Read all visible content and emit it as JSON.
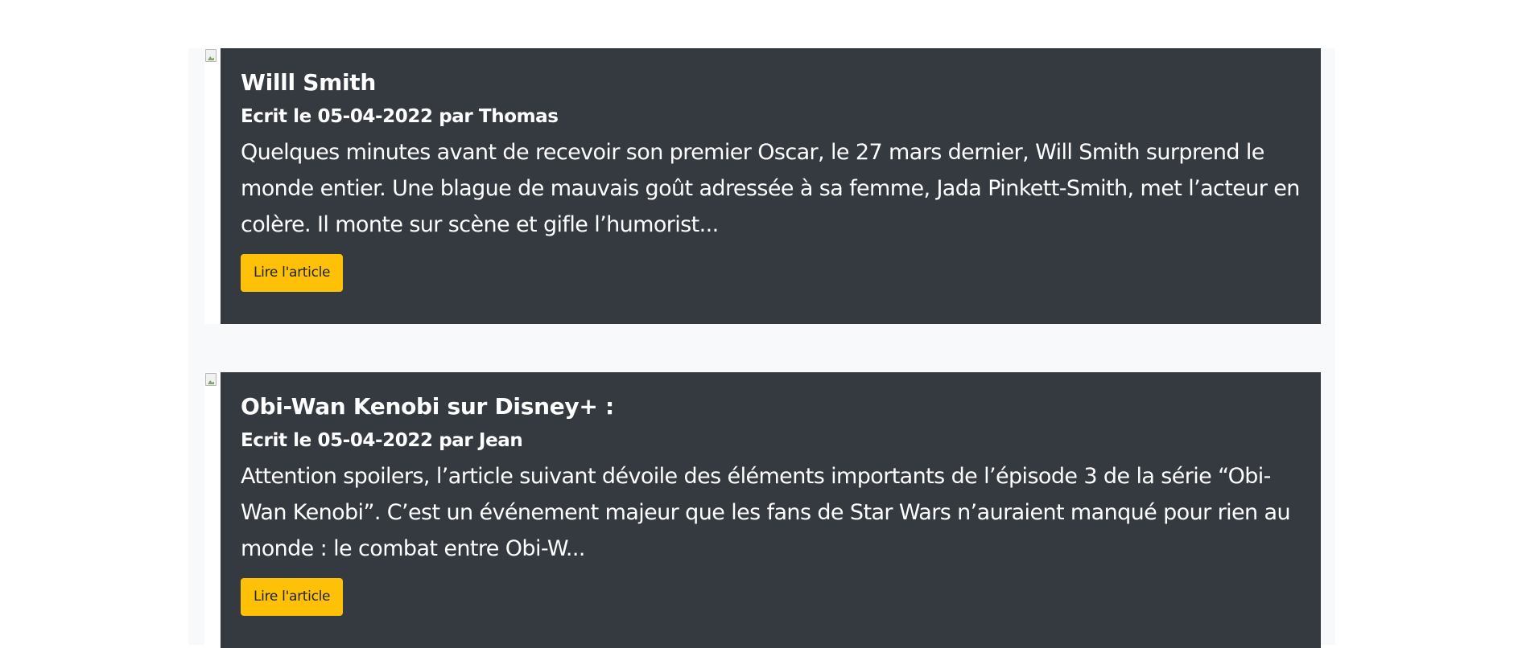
{
  "articles": [
    {
      "title": "Willl Smith",
      "meta": "Ecrit le 05-04-2022 par Thomas",
      "excerpt": "Quelques minutes avant de recevoir son premier Oscar, le 27 mars dernier, Will Smith surprend le monde entier. Une blague de mauvais goût adressée à sa femme, Jada Pinkett-Smith, met l’acteur en colère. Il monte sur scène et gifle l’humorist...",
      "button_label": "Lire l'article"
    },
    {
      "title": "Obi-Wan Kenobi sur Disney+ :",
      "meta": "Ecrit le 05-04-2022 par Jean",
      "excerpt": "Attention spoilers, l’article suivant dévoile des éléments importants de l’épisode 3 de la série “Obi-Wan Kenobi”. C’est un événement majeur que les fans de Star Wars n’auraient manqué pour rien au monde : le combat entre Obi-W...",
      "button_label": "Lire l'article"
    }
  ],
  "colors": {
    "card_background": "#343a40",
    "button_background": "#ffc107",
    "page_background": "#f8f9fa"
  }
}
